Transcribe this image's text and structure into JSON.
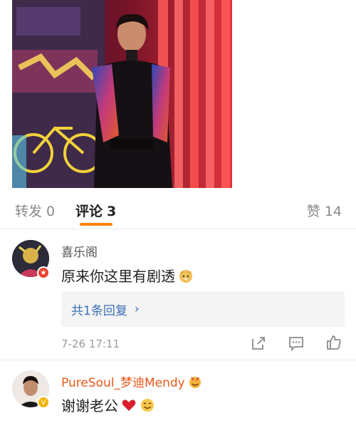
{
  "tabs": {
    "repost": {
      "label": "转发",
      "count": "0"
    },
    "comment": {
      "label": "评论",
      "count": "3"
    },
    "like": {
      "label": "赞",
      "count": "14"
    }
  },
  "comments": [
    {
      "username": "喜乐阁",
      "text": "原来你这里有剧透",
      "emoji": "doge-emoji",
      "reply_summary": "共1条回复",
      "time": "7-26 17:11",
      "actions": [
        "share-icon",
        "comment-icon",
        "like-icon"
      ]
    },
    {
      "username": "PureSoul_梦迪Mendy",
      "text": "谢谢老公",
      "emoji": [
        "heart-emoji",
        "smile-emoji"
      ]
    }
  ],
  "colors": {
    "accent": "#ff8200",
    "link": "#3a6fb6",
    "vip_name": "#e8591a"
  }
}
